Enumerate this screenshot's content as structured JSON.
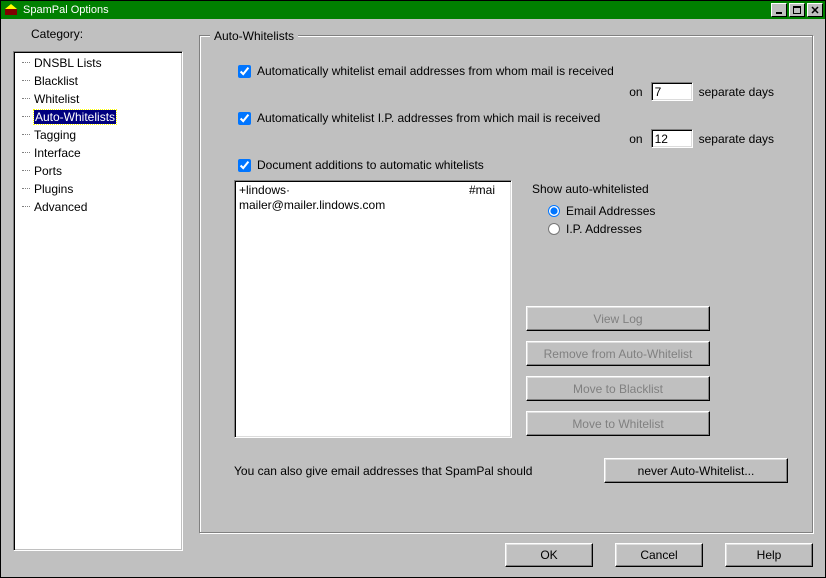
{
  "window": {
    "title": "SpamPal Options"
  },
  "sidebar": {
    "label": "Category:",
    "items": [
      "DNSBL Lists",
      "Blacklist",
      "Whitelist",
      "Auto-Whitelists",
      "Tagging",
      "Interface",
      "Ports",
      "Plugins",
      "Advanced"
    ],
    "selected_index": 3
  },
  "group": {
    "title": "Auto-Whitelists",
    "check_email": "Automatically whitelist email addresses from whom mail is received",
    "check_ip": "Automatically whitelist I.P. addresses from which mail is received",
    "check_doc": "Document additions to automatic whitelists",
    "on_label": "on",
    "sep_days": "separate days",
    "email_days": "7",
    "ip_days": "12"
  },
  "listbox": {
    "rows": [
      {
        "addr": "+lindows·",
        "tag": "#mai"
      },
      {
        "addr": "mailer@mailer.lindows.com",
        "tag": ""
      }
    ]
  },
  "show": {
    "label": "Show auto-whitelisted",
    "opt_email": "Email Addresses",
    "opt_ip": "I.P. Addresses"
  },
  "buttons": {
    "view_log": "View Log",
    "remove": "Remove from Auto-Whitelist",
    "move_black": "Move to Blacklist",
    "move_white": "Move to Whitelist",
    "never": "never Auto-Whitelist..."
  },
  "footer_text": "You can also give email addresses that SpamPal should",
  "bottom": {
    "ok": "OK",
    "cancel": "Cancel",
    "help": "Help"
  }
}
